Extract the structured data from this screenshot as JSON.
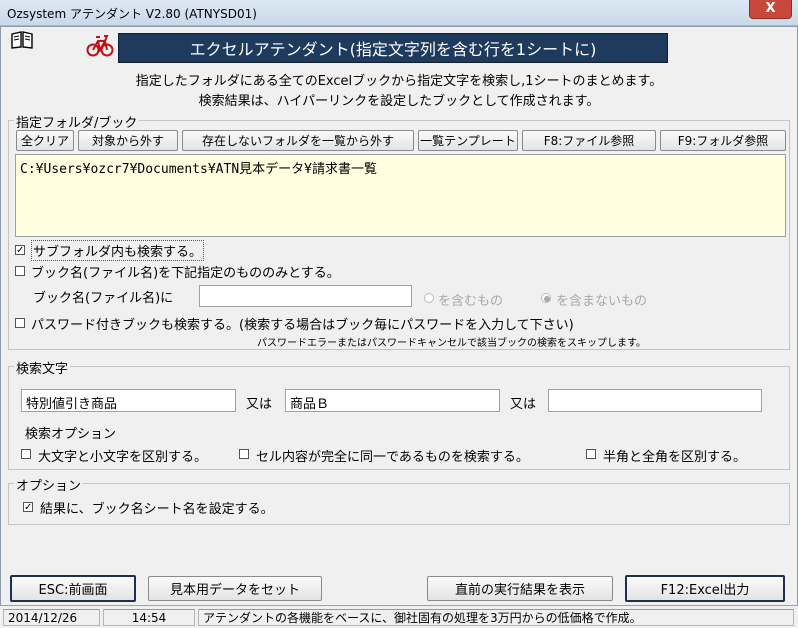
{
  "window": {
    "title": "Ozsystem アテンダント V2.80 (ATNYSD01)",
    "close_label": "X"
  },
  "icons": {
    "book": "book-icon",
    "bicycle": "bicycle-icon"
  },
  "header": {
    "banner": "エクセルアテンダント(指定文字列を含む行を1シートに)",
    "desc_line1": "指定したフォルダにある全てのExcelブックから指定文字を検索し,1シートのまとめます。",
    "desc_line2": "検索結果は、ハイパーリンクを設定したブックとして作成されます。"
  },
  "folder_group": {
    "legend": "指定フォルダ/ブック",
    "buttons": [
      "全クリア",
      "対象から外す",
      "存在しないフォルダを一覧から外す",
      "一覧テンプレート",
      "F8:ファイル参照",
      "F9:フォルダ参照"
    ],
    "list_items": [
      "C:¥Users¥ozcr7¥Documents¥ATN見本データ¥請求書一覧"
    ],
    "subfolder_label": "サブフォルダ内も検索する。",
    "subfolder_checked": true,
    "bookname_only_label": "ブック名(ファイル名)を下記指定のもののみとする。",
    "bookname_only_checked": false,
    "bookname_label": "ブック名(ファイル名)に",
    "bookname_value": "",
    "radio_include": "を含むもの",
    "radio_exclude": "を含まないもの",
    "radio_selected": "exclude",
    "password_label": "パスワード付きブックも検索する。(検索する場合はブック毎にパスワードを入力して下さい)",
    "password_checked": false,
    "password_note": "パスワードエラーまたはパスワードキャンセルで該当ブックの検索をスキップします。"
  },
  "search_group": {
    "legend": "検索文字",
    "term1": "特別値引き商品",
    "or1": "又は",
    "term2": "商品Ｂ",
    "or2": "又は",
    "term3": "",
    "options_label": "検索オプション",
    "opt_case": "大文字と小文字を区別する。",
    "opt_exact": "セル内容が完全に同一であるものを検索する。",
    "opt_width": "半角と全角を区別する。",
    "opt_case_checked": false,
    "opt_exact_checked": false,
    "opt_width_checked": false
  },
  "option_group": {
    "legend": "オプション",
    "set_name_label": "結果に、ブック名シート名を設定する。",
    "set_name_checked": true
  },
  "footer_buttons": {
    "esc": "ESC:前画面",
    "sample": "見本用データをセット",
    "last_result": "直前の実行結果を表示",
    "f12": "F12:Excel出力"
  },
  "statusbar": {
    "date": "2014/12/26",
    "time": "14:54",
    "message": "アテンダントの各機能をベースに、御社固有の処理を3万円からの低価格で作成。"
  }
}
